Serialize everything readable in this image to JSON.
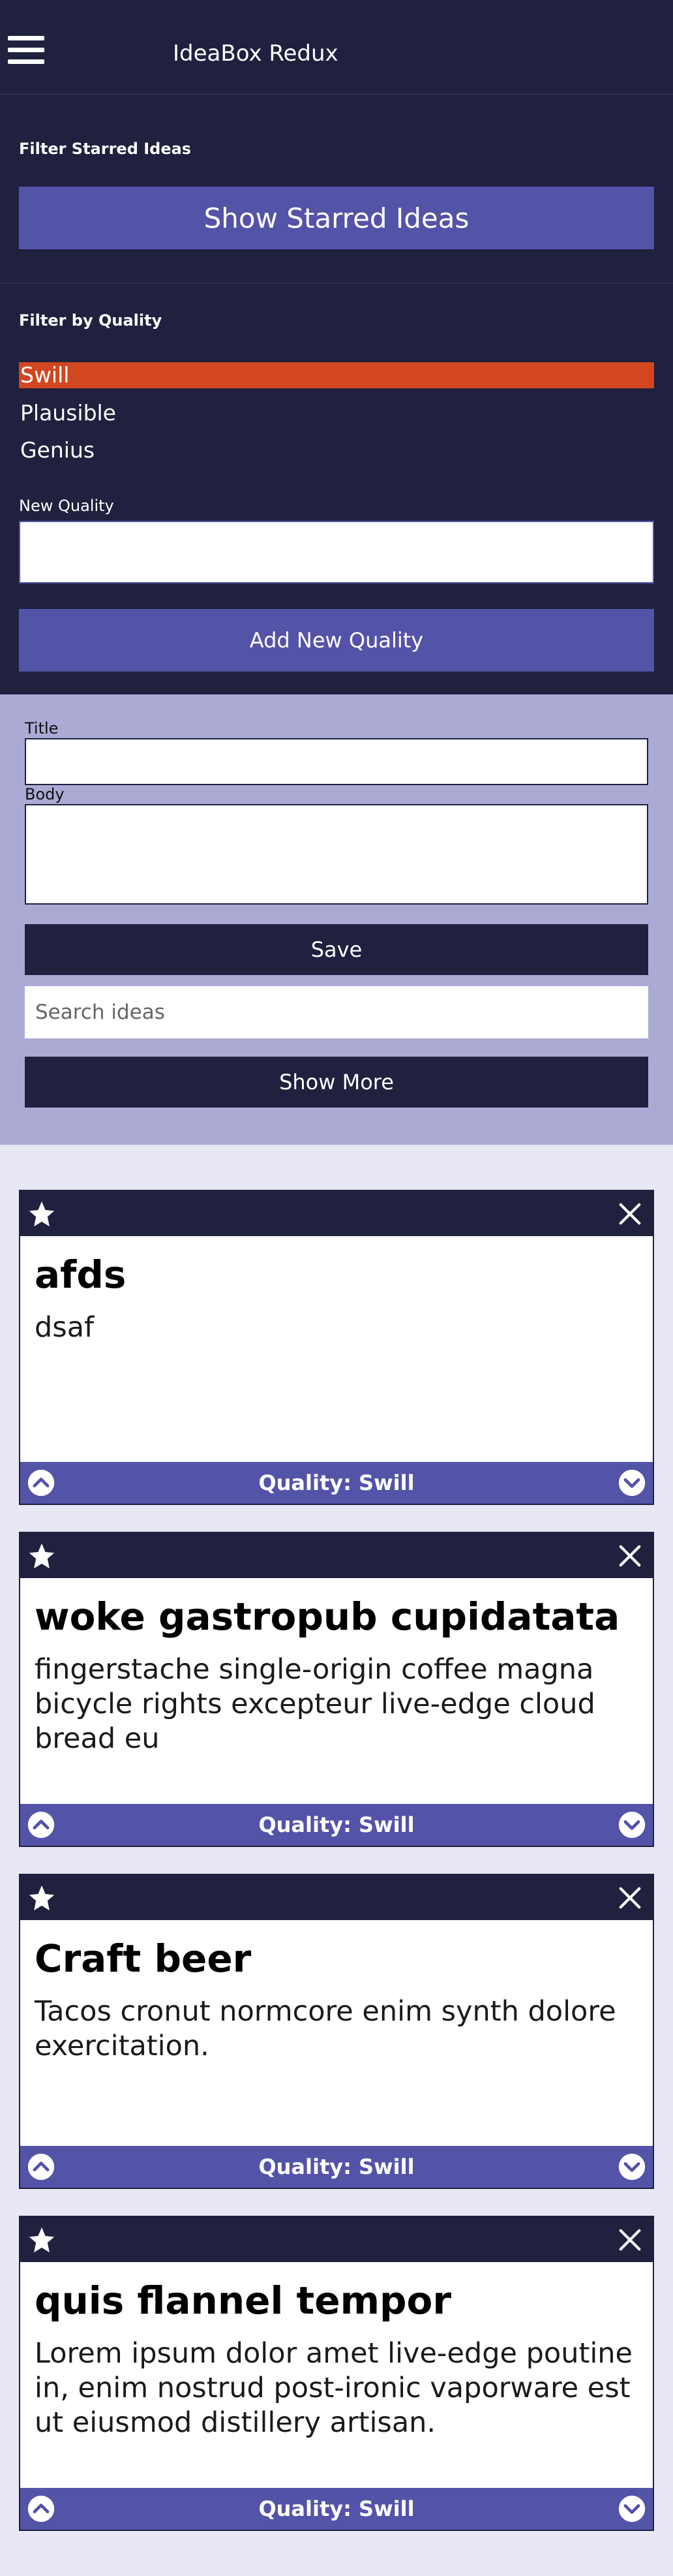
{
  "app": {
    "title": "IdeaBox Redux"
  },
  "filters": {
    "starred_label": "Filter Starred Ideas",
    "starred_button": "Show Starred Ideas",
    "quality_label": "Filter by Quality",
    "qualities": [
      "Swill",
      "Plausible",
      "Genius"
    ],
    "active_quality": "Swill",
    "new_quality_label": "New Quality",
    "new_quality_value": "",
    "add_quality_button": "Add New Quality"
  },
  "form": {
    "title_label": "Title",
    "title_value": "",
    "body_label": "Body",
    "body_value": "",
    "save_button": "Save",
    "search_placeholder": "Search ideas",
    "show_more_button": "Show More"
  },
  "ideas": [
    {
      "title": "afds",
      "body": "dsaf",
      "quality": "Quality: Swill"
    },
    {
      "title": "woke gastropub cupidatata",
      "body": "fingerstache single-origin coffee magna bicycle rights excepteur live-edge cloud bread eu",
      "quality": "Quality: Swill"
    },
    {
      "title": "Craft beer",
      "body": "Tacos cronut normcore enim synth dolore exercitation.",
      "quality": "Quality: Swill"
    },
    {
      "title": "quis flannel tempor",
      "body": "Lorem ipsum dolor amet live-edge poutine in, enim nostrud post-ironic vaporware est ut eiusmod distillery artisan.",
      "quality": "Quality: Swill"
    }
  ],
  "colors": {
    "dark": "#20203f",
    "accent": "#5353a8",
    "active": "#d24620",
    "form_bg": "#abaad5",
    "page_bg": "#e8e8f4"
  },
  "icons": {
    "menu": "hamburger-icon",
    "star": "star-icon",
    "close": "close-icon",
    "up": "chevron-up-icon",
    "down": "chevron-down-icon"
  }
}
